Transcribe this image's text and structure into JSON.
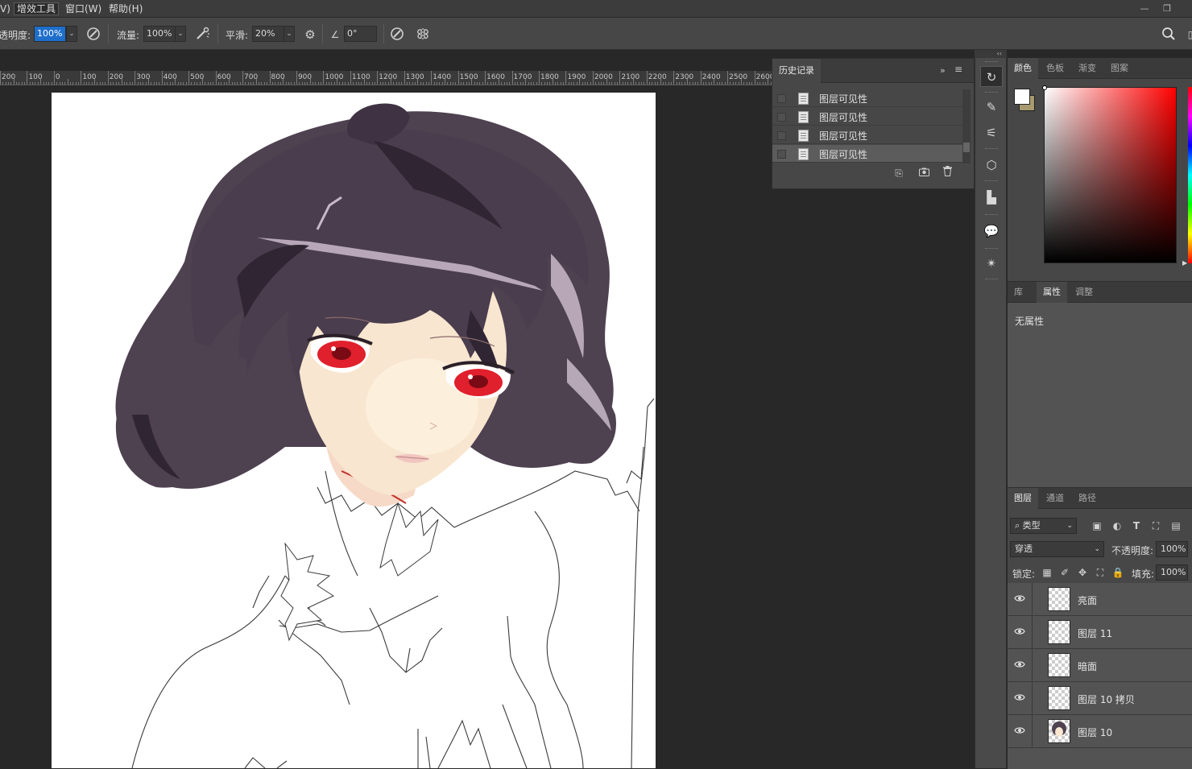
{
  "menubar": {
    "items": [
      "V)",
      "增效工具",
      "窗口(W)",
      "帮助(H)"
    ],
    "active_index": 1
  },
  "options": {
    "opacity_label": "透明度:",
    "opacity_value": "100%",
    "flow_label": "流量:",
    "flow_value": "100%",
    "smooth_label": "平滑:",
    "smooth_value": "20%",
    "angle_value": "0°"
  },
  "ruler": {
    "labels": [
      "200",
      "100",
      "0",
      "100",
      "200",
      "300",
      "400",
      "500",
      "600",
      "700",
      "800",
      "900",
      "1000",
      "1100",
      "1200",
      "1300",
      "1400",
      "1500",
      "1600",
      "1700",
      "1800",
      "1900",
      "2000",
      "2100",
      "2200",
      "2300",
      "2400",
      "2500",
      "2600"
    ]
  },
  "history": {
    "title": "历史记录",
    "rows": [
      "图层可见性",
      "图层可见性",
      "图层可见性",
      "图层可见性"
    ],
    "current_index": 3
  },
  "color_panel": {
    "tabs": [
      "颜色",
      "色板",
      "渐变",
      "图案"
    ],
    "active": 0,
    "foreground": "#ffffff",
    "background": "#a89a6e"
  },
  "properties": {
    "tabs": [
      "库",
      "属性",
      "调整"
    ],
    "active": 1,
    "empty_text": "无属性"
  },
  "layers_panel": {
    "tabs": [
      "图层",
      "通道",
      "路径"
    ],
    "active": 0,
    "filter_label": "类型",
    "blend_mode": "穿透",
    "opacity_label": "不透明度:",
    "opacity_value": "100%",
    "lock_label": "锁定:",
    "fill_label": "填充:",
    "fill_value": "100%",
    "layers": [
      "亮面",
      "图层 11",
      "暗面",
      "图层 10 拷贝",
      "图层 10"
    ]
  },
  "colors": {
    "hair": "#4e4150",
    "hair_dark": "#2f2533",
    "skin": "#f9e7d2",
    "eye": "#e0202c",
    "accent_blue": "#1e6ecb"
  }
}
